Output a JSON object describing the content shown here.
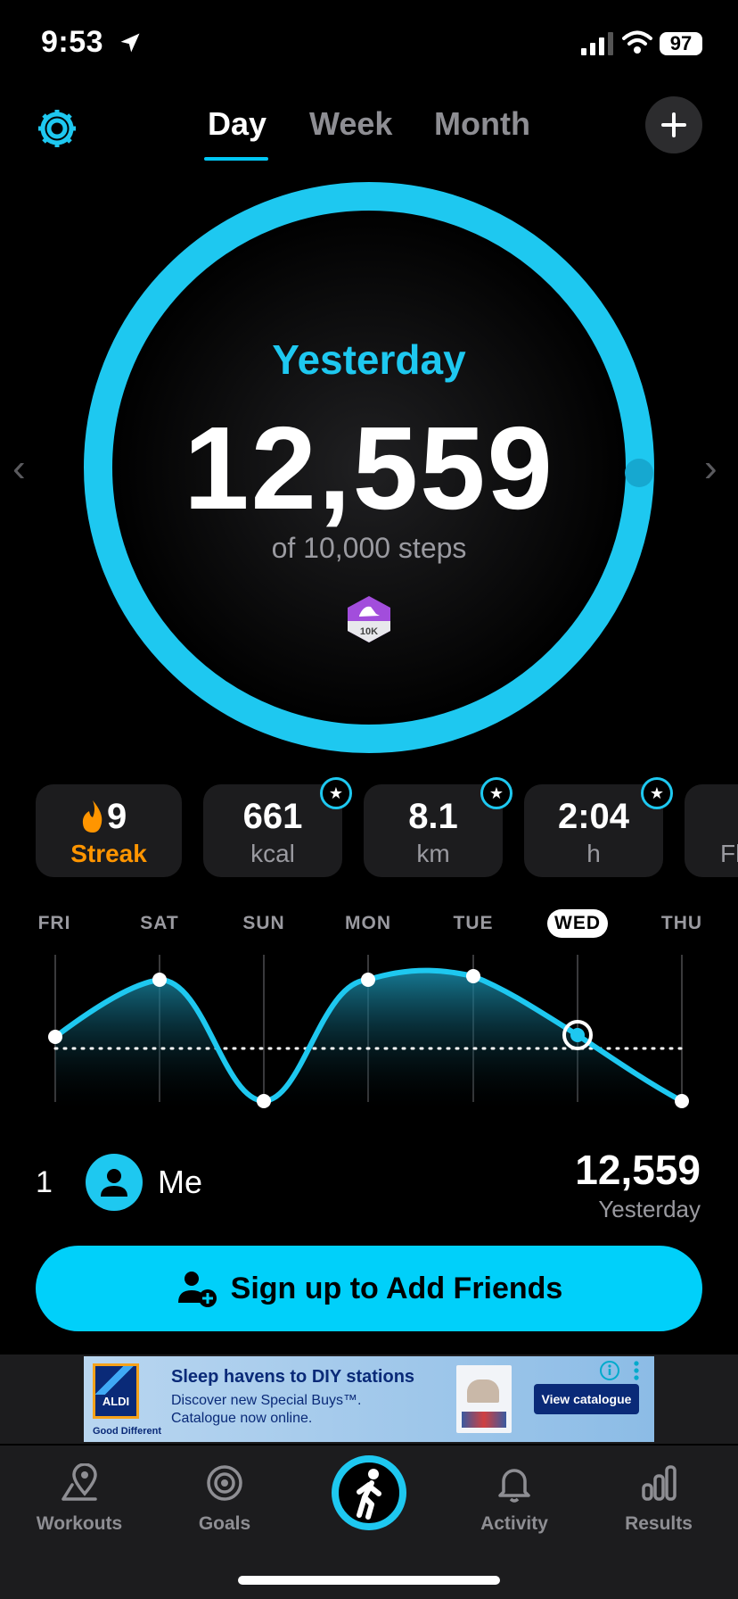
{
  "status_bar": {
    "time": "9:53",
    "battery": "97"
  },
  "tabs": [
    {
      "label": "Day",
      "active": true
    },
    {
      "label": "Week",
      "active": false
    },
    {
      "label": "Month",
      "active": false
    }
  ],
  "ring": {
    "label": "Yesterday",
    "value": "12,559",
    "subtitle": "of 10,000 steps",
    "badge": "10K",
    "progress": 1.2559,
    "color": "#1ec8f0"
  },
  "stats": [
    {
      "value": "9",
      "unit": "Streak"
    },
    {
      "value": "661",
      "unit": "kcal"
    },
    {
      "value": "8.1",
      "unit": "km"
    },
    {
      "value": "2:04",
      "unit": "h"
    },
    {
      "value": "",
      "unit": "Fl"
    }
  ],
  "week": {
    "days": [
      "FRI",
      "SAT",
      "SUN",
      "MON",
      "TUE",
      "WED",
      "THU"
    ],
    "selected": "WED"
  },
  "leaderboard": {
    "rank": "1",
    "name": "Me",
    "value": "12,559",
    "period": "Yesterday"
  },
  "cta": {
    "label": "Sign up to Add Friends"
  },
  "ad": {
    "brand": "ALDI",
    "tagline": "Good Different",
    "headline": "Sleep havens to DIY stations",
    "body_line1": "Discover new Special Buys™.",
    "body_line2": "Catalogue now online.",
    "button": "View catalogue"
  },
  "tab_bar": [
    {
      "label": "Workouts",
      "icon": "map-pin-icon"
    },
    {
      "label": "Goals",
      "icon": "target-icon"
    },
    {
      "label": "",
      "icon": "walking-icon"
    },
    {
      "label": "Activity",
      "icon": "bell-icon"
    },
    {
      "label": "Results",
      "icon": "bar-chart-icon"
    }
  ],
  "accent": "#00d0fa",
  "streak_color": "#ff9500"
}
